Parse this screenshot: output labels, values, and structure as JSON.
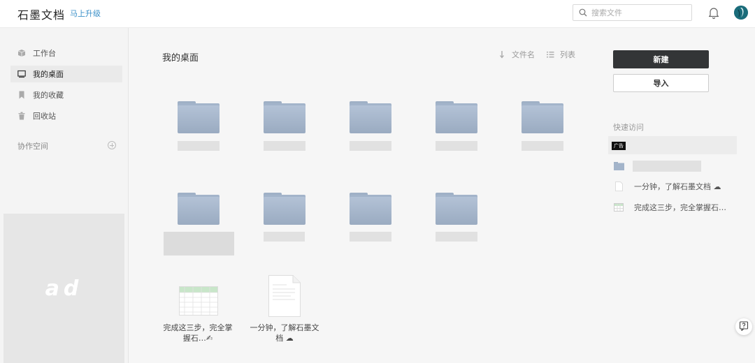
{
  "header": {
    "logo": "石墨文档",
    "upgrade": "马上升级",
    "search_placeholder": "搜索文件"
  },
  "sidebar": {
    "items": [
      {
        "label": "工作台",
        "icon": "box-icon"
      },
      {
        "label": "我的桌面",
        "icon": "monitor-icon"
      },
      {
        "label": "我的收藏",
        "icon": "bookmark-icon"
      },
      {
        "label": "回收站",
        "icon": "trash-icon"
      }
    ],
    "collab_label": "协作空间",
    "ad_text": "ad"
  },
  "main": {
    "title": "我的桌面",
    "sort_label": "文件名",
    "view_label": "列表",
    "files": [
      {
        "label": "完成这三步，完全掌握石…✍"
      },
      {
        "label": "一分钟，了解石墨文档 ☁"
      }
    ]
  },
  "right": {
    "new_label": "新建",
    "import_label": "导入",
    "quick_title": "快速访问",
    "ad_tag": "广告",
    "quick_items": [
      {
        "label": "一分钟，了解石墨文档 ☁"
      },
      {
        "label": "完成这三步，完全掌握石…"
      }
    ]
  },
  "colors": {
    "folder": "#a3b4ca",
    "primary_button": "#333537",
    "link": "#3a8fc8"
  }
}
